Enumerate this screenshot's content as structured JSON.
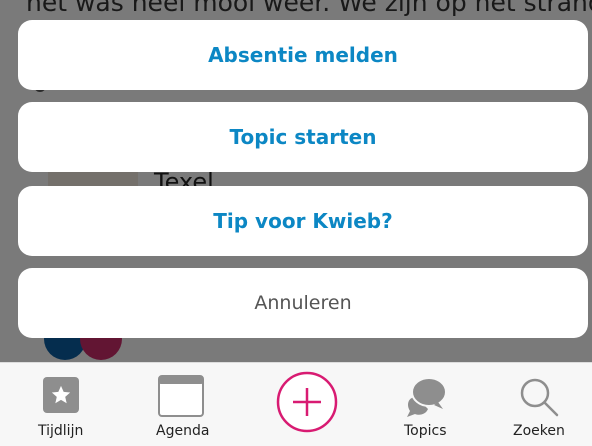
{
  "background": {
    "top_text": "het was heel mooi weer. We zijn op het strand",
    "title_text": "Texel"
  },
  "action_sheet": {
    "items": [
      {
        "label": "Absentie melden"
      },
      {
        "label": "Topic starten"
      },
      {
        "label": "Tip voor Kwieb?"
      }
    ],
    "cancel_label": "Annuleren"
  },
  "tabbar": {
    "tabs": [
      {
        "label": "Tijdlijn",
        "icon": "star-icon"
      },
      {
        "label": "Agenda",
        "icon": "calendar-icon"
      },
      {
        "label": "",
        "icon": "plus-icon"
      },
      {
        "label": "Topics",
        "icon": "chat-bubbles-icon"
      },
      {
        "label": "Zoeken",
        "icon": "search-icon"
      }
    ]
  },
  "colors": {
    "accent_blue": "#0c87c4",
    "accent_pink": "#d81b72",
    "icon_gray": "#8e8e8e"
  }
}
